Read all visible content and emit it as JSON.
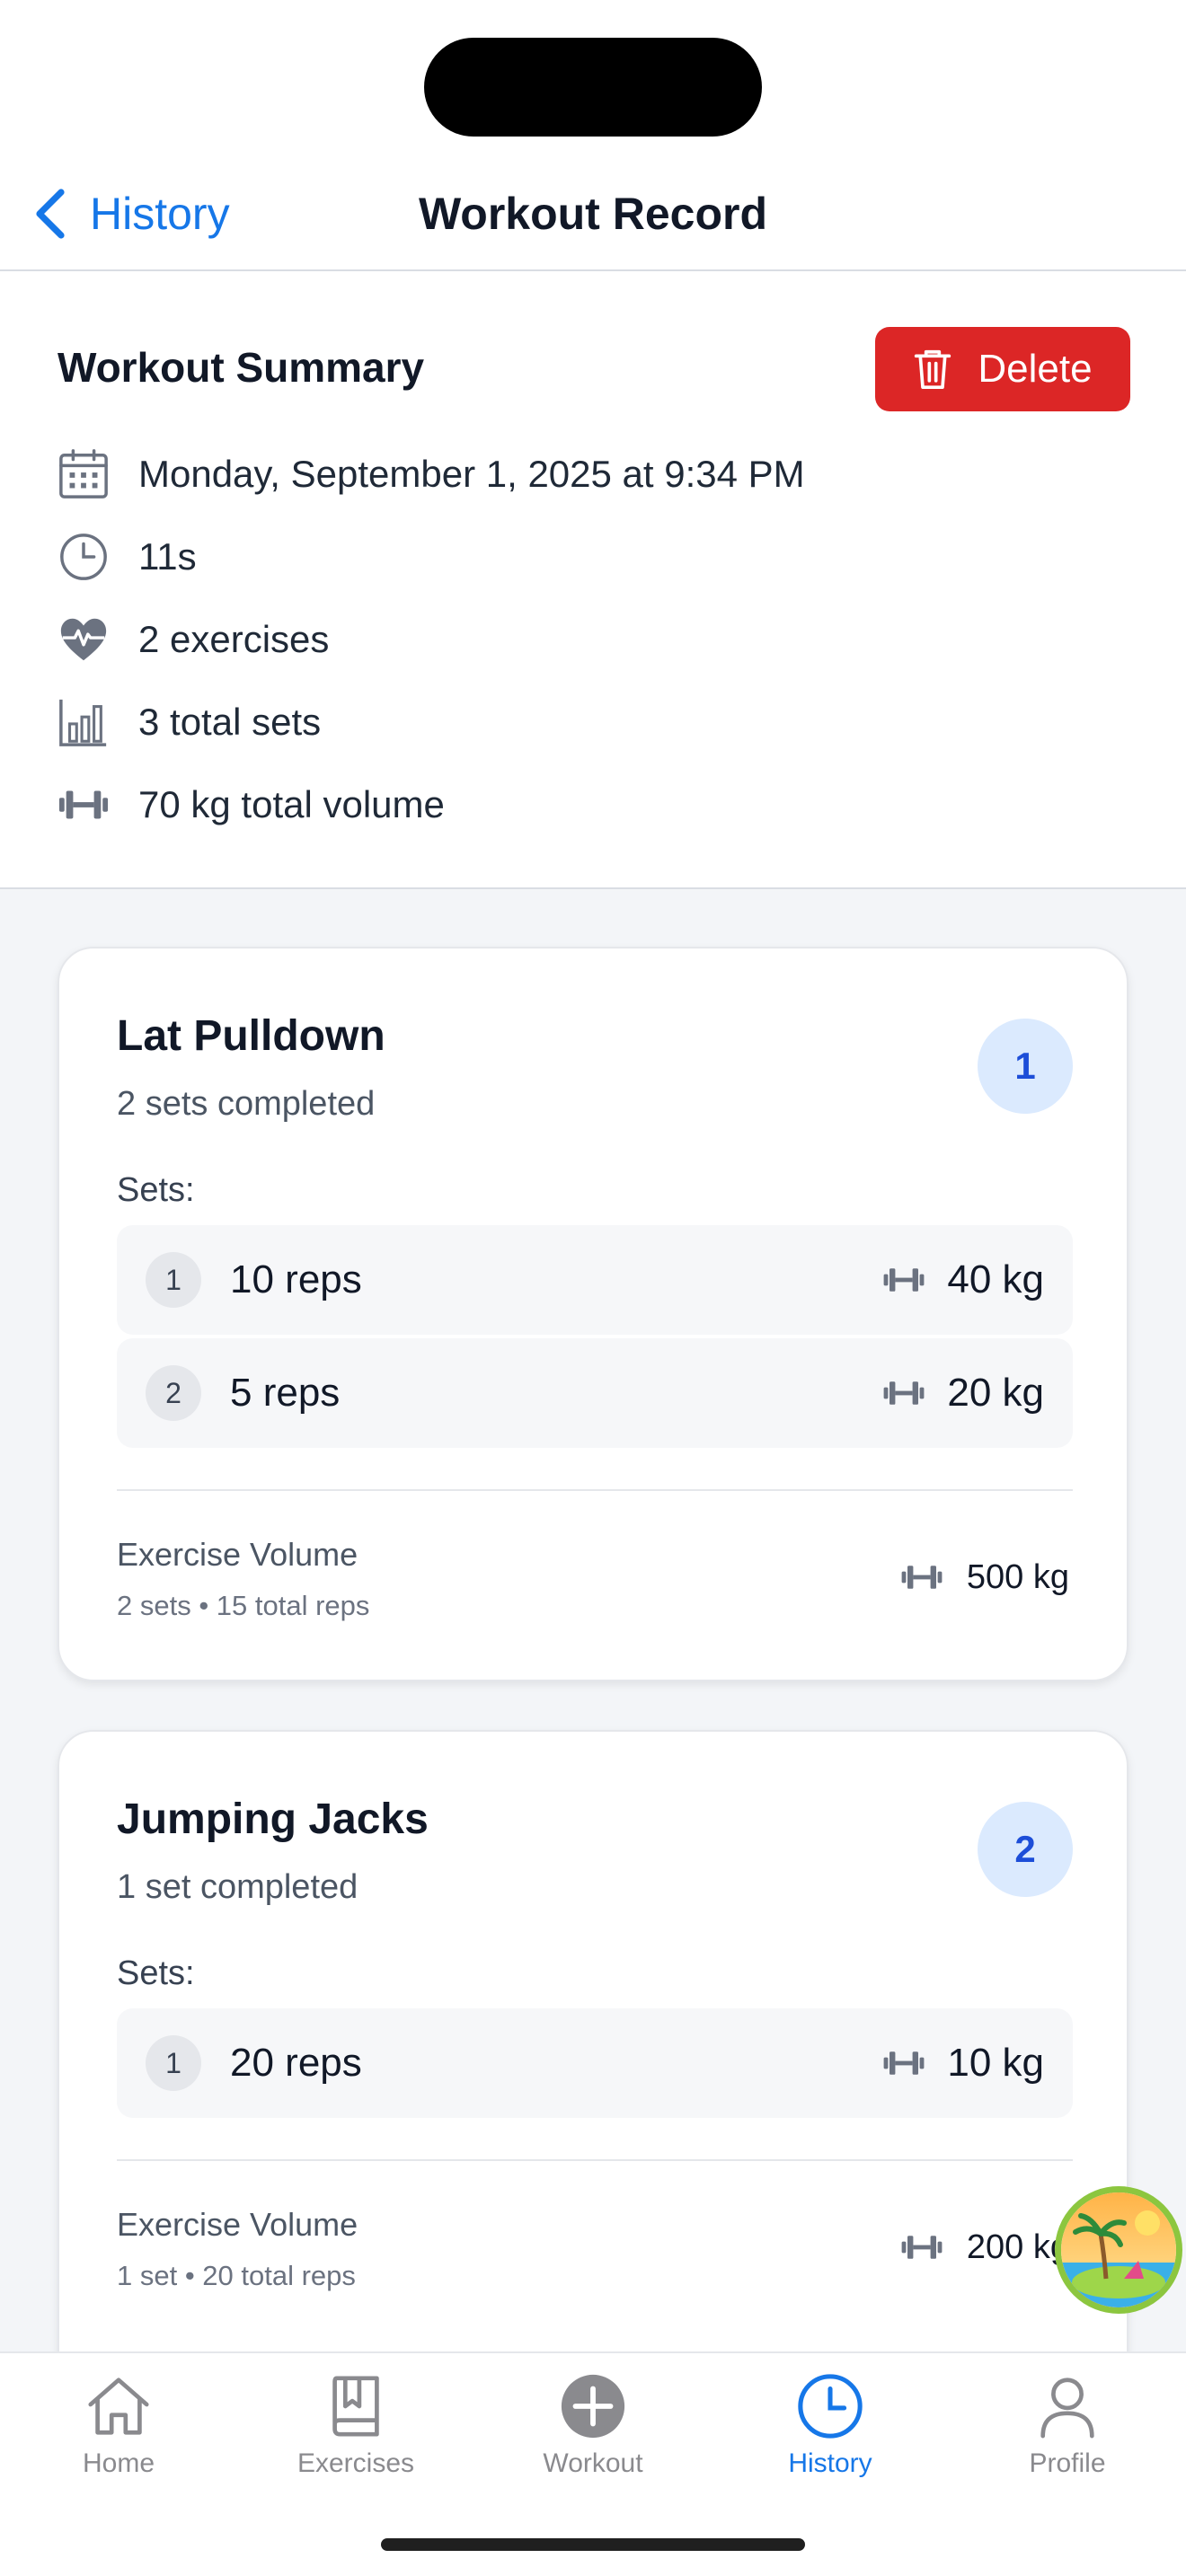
{
  "nav": {
    "back_label": "History",
    "title": "Workout Record"
  },
  "summary": {
    "title": "Workout Summary",
    "delete_label": "Delete",
    "date": "Monday, September 1, 2025 at 9:34 PM",
    "duration": "11s",
    "exercises": "2 exercises",
    "total_sets": "3 total sets",
    "total_volume": "70 kg total volume"
  },
  "exercises": [
    {
      "name": "Lat Pulldown",
      "subtitle": "2 sets completed",
      "index": "1",
      "sets_label": "Sets:",
      "sets": [
        {
          "num": "1",
          "reps": "10 reps",
          "weight": "40 kg"
        },
        {
          "num": "2",
          "reps": "5 reps",
          "weight": "20 kg"
        }
      ],
      "volume_label": "Exercise Volume",
      "volume_sub": "2 sets • 15 total reps",
      "volume_value": "500 kg"
    },
    {
      "name": "Jumping Jacks",
      "subtitle": "1 set completed",
      "index": "2",
      "sets_label": "Sets:",
      "sets": [
        {
          "num": "1",
          "reps": "20 reps",
          "weight": "10 kg"
        }
      ],
      "volume_label": "Exercise Volume",
      "volume_sub": "1 set • 20 total reps",
      "volume_value": "200 kg"
    }
  ],
  "tabs": [
    {
      "label": "Home",
      "icon": "house-icon",
      "active": false
    },
    {
      "label": "Exercises",
      "icon": "book-icon",
      "active": false
    },
    {
      "label": "Workout",
      "icon": "plus-circle-icon",
      "active": false
    },
    {
      "label": "History",
      "icon": "clock-icon",
      "active": true
    },
    {
      "label": "Profile",
      "icon": "person-icon",
      "active": false
    }
  ],
  "colors": {
    "accent": "#1677e8",
    "danger": "#dc2626",
    "badge_bg": "#dbeafe",
    "badge_text": "#1d4ed8"
  }
}
